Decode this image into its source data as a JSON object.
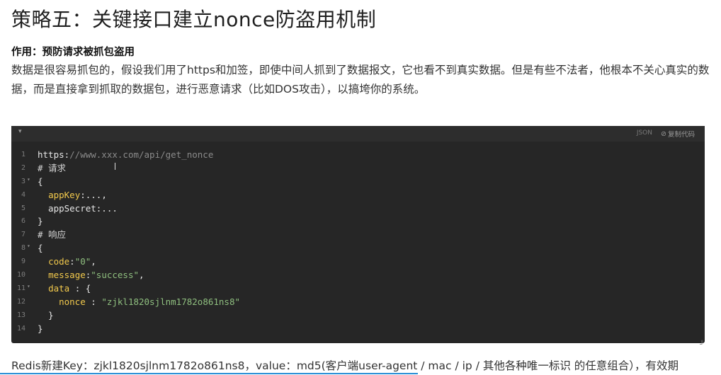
{
  "heading": "策略五：关键接口建立nonce防盗用机制",
  "subheading": "作用：预防请求被抓包盗用",
  "description": "数据是很容易抓包的，假设我们用了https和加签，即使中间人抓到了数据报文，它也看不到真实数据。但是有些不法者，他根本不关心真实的数据，而是直接拿到抓取的数据包，进行恶意请求（比如DOS攻击），以搞垮你的系统。",
  "code_block": {
    "language": "JSON",
    "copy_label": "复制代码",
    "copy_icon": "link-icon",
    "toggle_icon": "chevron-down-icon",
    "lines": [
      {
        "n": "1",
        "fold": false,
        "tokens": [
          {
            "t": "https:",
            "c": "plain"
          },
          {
            "t": "//www.xxx.com/api/get_nonce",
            "c": "url"
          }
        ]
      },
      {
        "n": "2",
        "fold": false,
        "tokens": [
          {
            "t": "# 请求",
            "c": "comment"
          }
        ]
      },
      {
        "n": "3",
        "fold": true,
        "tokens": [
          {
            "t": "{",
            "c": "plain"
          }
        ]
      },
      {
        "n": "4",
        "fold": false,
        "tokens": [
          {
            "t": "  ",
            "c": "plain"
          },
          {
            "t": "appKey",
            "c": "key"
          },
          {
            "t": ":...,",
            "c": "plain"
          }
        ]
      },
      {
        "n": "5",
        "fold": false,
        "tokens": [
          {
            "t": "  appSecret:...",
            "c": "plain"
          }
        ]
      },
      {
        "n": "6",
        "fold": false,
        "tokens": [
          {
            "t": "}",
            "c": "plain"
          }
        ]
      },
      {
        "n": "7",
        "fold": false,
        "tokens": [
          {
            "t": "# 响应",
            "c": "comment"
          }
        ]
      },
      {
        "n": "8",
        "fold": true,
        "tokens": [
          {
            "t": "{",
            "c": "plain"
          }
        ]
      },
      {
        "n": "9",
        "fold": false,
        "tokens": [
          {
            "t": "  ",
            "c": "plain"
          },
          {
            "t": "code",
            "c": "key"
          },
          {
            "t": ":",
            "c": "plain"
          },
          {
            "t": "\"0\"",
            "c": "str"
          },
          {
            "t": ",",
            "c": "plain"
          }
        ]
      },
      {
        "n": "10",
        "fold": false,
        "tokens": [
          {
            "t": "  ",
            "c": "plain"
          },
          {
            "t": "message",
            "c": "key"
          },
          {
            "t": ":",
            "c": "plain"
          },
          {
            "t": "\"success\"",
            "c": "str"
          },
          {
            "t": ",",
            "c": "plain"
          }
        ]
      },
      {
        "n": "11",
        "fold": true,
        "tokens": [
          {
            "t": "  ",
            "c": "plain"
          },
          {
            "t": "data",
            "c": "key"
          },
          {
            "t": " : {",
            "c": "plain"
          }
        ]
      },
      {
        "n": "12",
        "fold": false,
        "tokens": [
          {
            "t": "    ",
            "c": "plain"
          },
          {
            "t": "nonce",
            "c": "key"
          },
          {
            "t": " : ",
            "c": "plain"
          },
          {
            "t": "\"zjkl1820sjlnm1782o861ns8\"",
            "c": "str"
          }
        ]
      },
      {
        "n": "13",
        "fold": false,
        "tokens": [
          {
            "t": "  }",
            "c": "plain"
          }
        ]
      },
      {
        "n": "14",
        "fold": false,
        "tokens": [
          {
            "t": "}",
            "c": "plain"
          }
        ]
      }
    ]
  },
  "bottom_text": "Redis新建Key：zjkl1820sjlnm1782o861ns8，value：md5(客户端user-agent / mac / ip / 其他各种唯一标识 的任意组合），有效期",
  "colors": {
    "code_bg": "#262626",
    "key": "#f2c94c",
    "string": "#8fbf7f",
    "url": "#8a8a8a",
    "accent_rule": "#2b8fd6"
  }
}
